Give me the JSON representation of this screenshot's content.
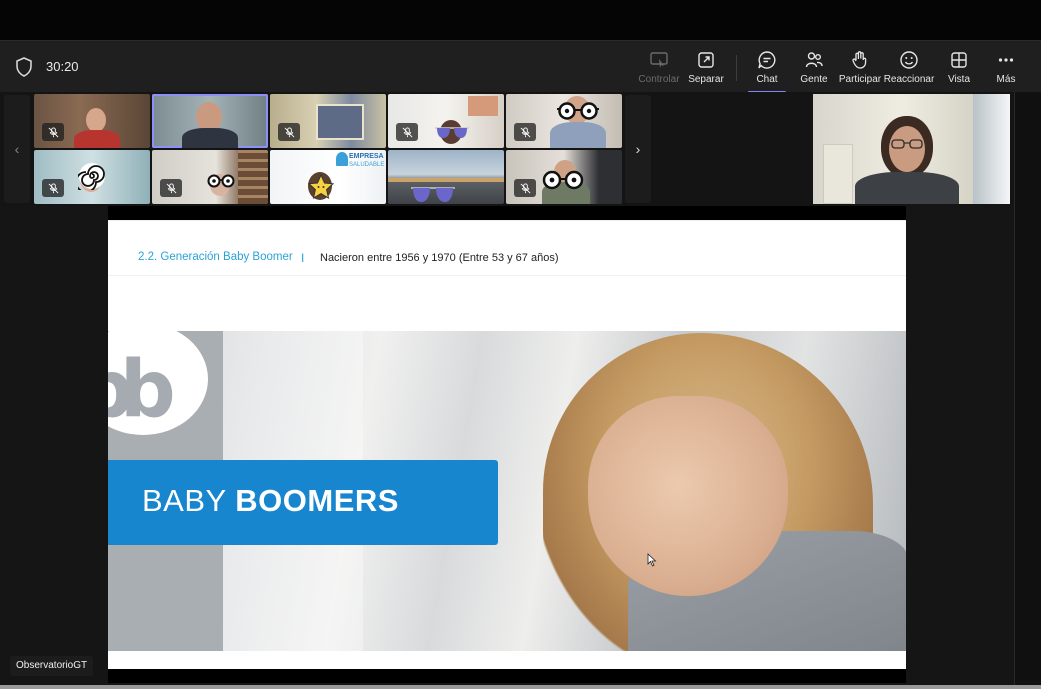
{
  "meeting": {
    "timer": "30:20",
    "presenter_name": "ObservatorioGT"
  },
  "toolbar": {
    "items": [
      {
        "label": "Controlar",
        "icon": "control-icon",
        "disabled": true
      },
      {
        "label": "Separar",
        "icon": "pop-out-icon"
      },
      {
        "label": "Chat",
        "icon": "chat-icon",
        "active": true
      },
      {
        "label": "Gente",
        "icon": "people-icon"
      },
      {
        "label": "Participar",
        "icon": "raise-hand-icon"
      },
      {
        "label": "Reaccionar",
        "icon": "smiley-icon"
      },
      {
        "label": "Vista",
        "icon": "grid-view-icon"
      },
      {
        "label": "Más",
        "icon": "more-icon"
      }
    ]
  },
  "gallery": {
    "tiles": [
      {
        "row": 1,
        "col": 1,
        "muted": true
      },
      {
        "row": 1,
        "col": 2,
        "selected": true
      },
      {
        "row": 1,
        "col": 3,
        "muted": true
      },
      {
        "row": 1,
        "col": 4,
        "muted": true,
        "overlay": "sunglasses"
      },
      {
        "row": 1,
        "col": 5,
        "muted": true,
        "overlay": "glasses"
      },
      {
        "row": 2,
        "col": 1,
        "muted": true,
        "overlay": "spiral"
      },
      {
        "row": 2,
        "col": 2,
        "muted": true,
        "overlay": "glasses"
      },
      {
        "row": 2,
        "col": 3,
        "overlay": "star"
      },
      {
        "row": 2,
        "col": 4,
        "overlay": "sunglasses"
      },
      {
        "row": 2,
        "col": 5,
        "muted": true,
        "overlay": "glasses"
      }
    ],
    "banner_text": {
      "line1": "EMPRESA",
      "line2": "SALUDABLE"
    }
  },
  "slide": {
    "section_title": "2.2. Generación Baby Boomer",
    "separator": "I",
    "subtitle": "Nacieron entre 1956 y 1970  (Entre 53 y 67 años)",
    "logo_text": "bb",
    "banner_light": "BABY ",
    "banner_bold": "BOOMERS"
  },
  "colors": {
    "accent": "#7f85f5",
    "slide_blue": "#1786cf",
    "section_cyan": "#2aa3d6"
  }
}
